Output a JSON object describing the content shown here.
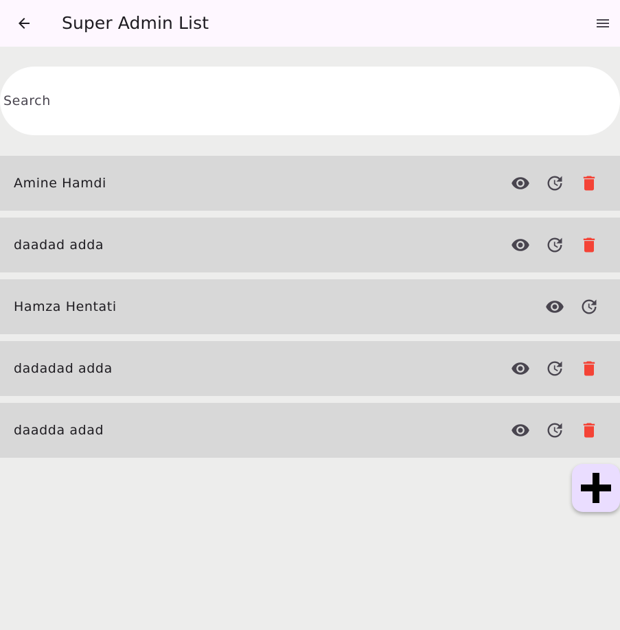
{
  "app_bar": {
    "title": "Super Admin List",
    "back_icon": "arrow-back-icon",
    "menu_icon": "menu-icon"
  },
  "search": {
    "placeholder": "Search",
    "value": ""
  },
  "admins": [
    {
      "name": "Amine Hamdi",
      "deletable": true
    },
    {
      "name": "daadad adda",
      "deletable": true
    },
    {
      "name": "Hamza Hentati",
      "deletable": false
    },
    {
      "name": "dadadad adda",
      "deletable": true
    },
    {
      "name": "daadda adad",
      "deletable": true
    }
  ],
  "row_icons": {
    "view": "eye-icon",
    "reset": "restore-clock-icon",
    "delete": "trash-icon"
  },
  "fab": {
    "icon": "plus-icon"
  },
  "colors": {
    "app_bar_bg": "#fef7ff",
    "page_bg": "#ededec",
    "row_bg": "#d8d8d8",
    "icon_gray": "#49454f",
    "delete_red": "#f44336",
    "fab_bg": "#eaddff"
  }
}
